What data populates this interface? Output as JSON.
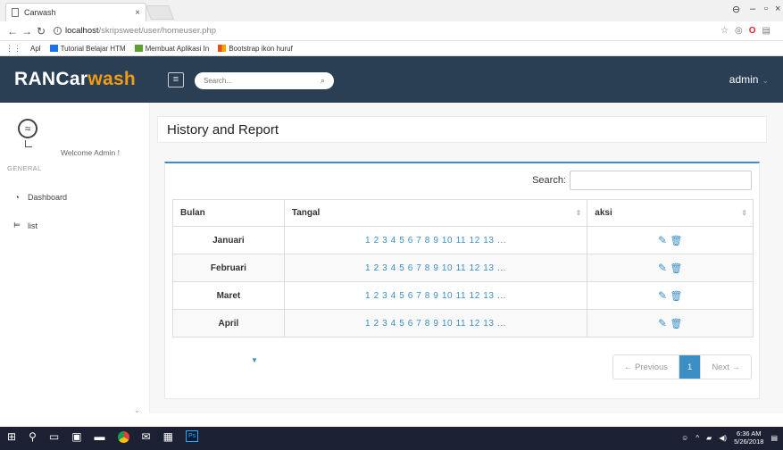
{
  "browser": {
    "tab_title": "Carwash",
    "tab_close": "×",
    "url_host": "localhost",
    "url_path": "/skripsweet/user/homeuser.php",
    "bookmarks": [
      {
        "label": "Apl",
        "color": "#f4a300"
      },
      {
        "label": "Tutorial Belajar HTM",
        "color": "#1a73e8"
      },
      {
        "label": "Membuat Aplikasi In",
        "color": "#5ba031"
      },
      {
        "label": "Bootstrap ikon huruf",
        "color": "#e84e1b"
      }
    ]
  },
  "header": {
    "brand_main": "RANCar",
    "brand_accent": "wash",
    "search_placeholder": "Search...",
    "user": "admin"
  },
  "sidebar": {
    "welcome": "Welcome Admin !",
    "section": "GENERAL",
    "items": [
      {
        "label": "Dashboard",
        "icon": "dashboard-icon"
      },
      {
        "label": "list",
        "icon": "cart-icon"
      }
    ]
  },
  "main": {
    "title": "History and Report",
    "search_label": "Search:",
    "columns": [
      "Bulan",
      "Tangal",
      "aksi"
    ],
    "rows": [
      {
        "bulan": "Januari",
        "tanggal": "1 2 3 4 5 6 7 8 9 10 11 12 13 ..."
      },
      {
        "bulan": "Februari",
        "tanggal": "1 2 3 4 5 6 7 8 9 10 11 12 13 ..."
      },
      {
        "bulan": "Maret",
        "tanggal": "1 2 3 4 5 6 7 8 9 10 11 12 13 ..."
      },
      {
        "bulan": "April",
        "tanggal": "1 2 3 4 5 6 7 8 9 10 11 12 13 ..."
      }
    ],
    "pagination": {
      "prev": "← Previous",
      "current": "1",
      "next": "Next →"
    }
  },
  "taskbar": {
    "time": "6:36 AM",
    "date": "5/26/2018"
  },
  "colors": {
    "header_bg": "#2a3f54",
    "brand_accent": "#f39c12",
    "link_blue": "#3b8fc4"
  }
}
